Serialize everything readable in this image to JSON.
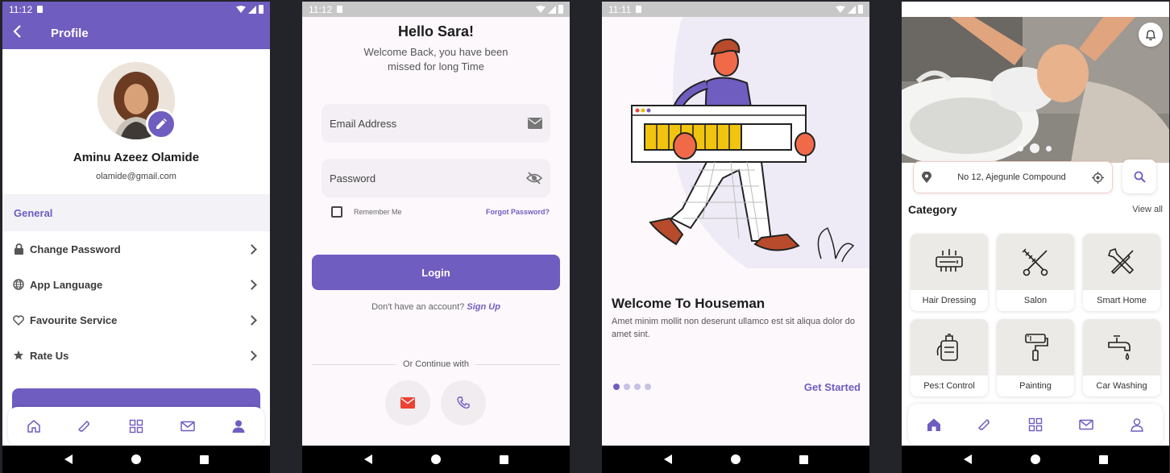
{
  "colors": {
    "primary": "#6f5dc0",
    "navbar": "#000000",
    "background": "#23242a"
  },
  "profile_screen": {
    "status_time": "11:12",
    "header_title": "Profile",
    "name": "Aminu Azeez Olamide",
    "email": "olamide@gmail.com",
    "section_title": "General",
    "menu": [
      {
        "label": "Change Password",
        "icon": "lock-icon"
      },
      {
        "label": "App Language",
        "icon": "globe-icon"
      },
      {
        "label": "Favourite Service",
        "icon": "heart-icon"
      },
      {
        "label": "Rate Us",
        "icon": "star-icon"
      }
    ],
    "tabs": [
      "home-icon",
      "ticket-icon",
      "grid-icon",
      "mail-icon",
      "user-icon"
    ],
    "active_tab": "user-icon"
  },
  "login_screen": {
    "status_time": "11:12",
    "title": "Hello Sara!",
    "subtitle": "Welcome Back, you have been missed for long Time",
    "email_placeholder": "Email Address",
    "password_placeholder": "Password",
    "remember_me": "Remember Me",
    "forgot_password": "Forgot Password?",
    "login_label": "Login",
    "no_account_text": "Don't have an account?",
    "sign_up_label": "Sign Up",
    "or_continue": "Or Continue with"
  },
  "onboarding_screen": {
    "status_time": "11:11",
    "title": "Welcome To Houseman",
    "description": "Amet minim mollit non deserunt ullamco est sit aliqua dolor do amet sint.",
    "page_count": 4,
    "active_page": 1,
    "cta_label": "Get Started"
  },
  "home_screen": {
    "location": "No 12, Ajegunle Compound",
    "category_title": "Category",
    "view_all": "View all",
    "categories": [
      {
        "label": "Hair Dressing",
        "icon": "hair-dryer-icon"
      },
      {
        "label": "Salon",
        "icon": "scissors-comb-icon"
      },
      {
        "label": "Smart Home",
        "icon": "tools-icon"
      },
      {
        "label": "Pes:t Control",
        "icon": "spray-tank-icon"
      },
      {
        "label": "Painting",
        "icon": "paint-roller-icon"
      },
      {
        "label": "Car Washing",
        "icon": "faucet-icon"
      }
    ],
    "active_tab": "home-icon"
  }
}
